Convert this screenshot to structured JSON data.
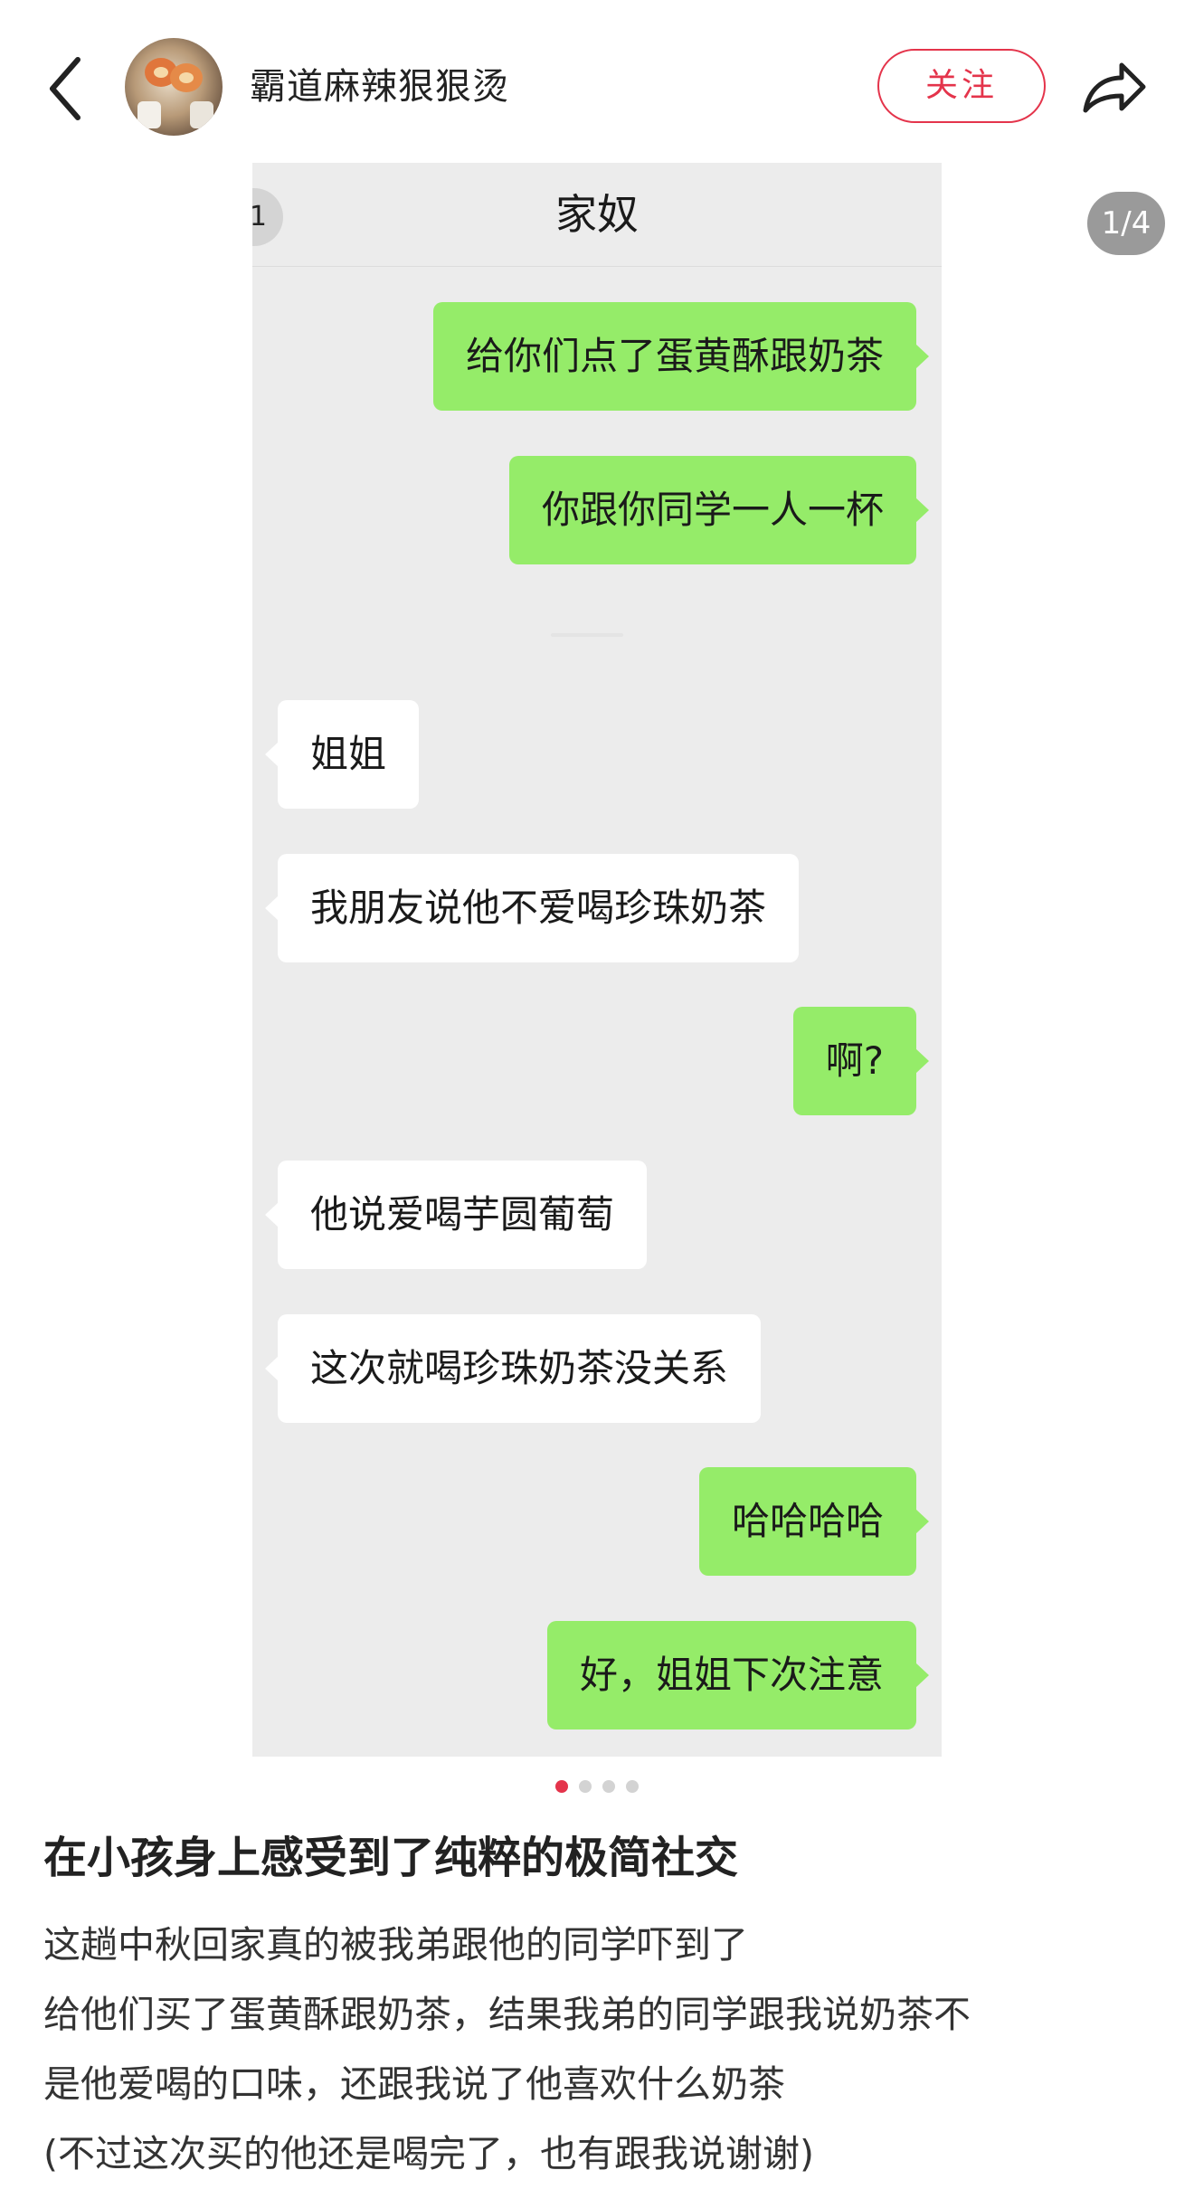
{
  "header": {
    "author_name": "霸道麻辣狠狠烫",
    "follow_label": "关注"
  },
  "image": {
    "counter": "1/4",
    "chat": {
      "title": "家奴",
      "unread_badge": "1",
      "messages": [
        {
          "side": "sent",
          "text": "给你们点了蛋黄酥跟奶茶"
        },
        {
          "side": "sent",
          "text": "你跟你同学一人一杯"
        },
        {
          "side": "recv",
          "text": "姐姐"
        },
        {
          "side": "recv",
          "text": "我朋友说他不爱喝珍珠奶茶"
        },
        {
          "side": "sent",
          "text": "啊?"
        },
        {
          "side": "recv",
          "text": "他说爱喝芋圆葡萄"
        },
        {
          "side": "recv",
          "text": "这次就喝珍珠奶茶没关系"
        },
        {
          "side": "sent",
          "text": "哈哈哈哈"
        },
        {
          "side": "sent",
          "text": "好，姐姐下次注意"
        }
      ]
    },
    "pages_total": 4,
    "active_page": 1
  },
  "post": {
    "title": "在小孩身上感受到了纯粹的极简社交",
    "body_lines": [
      "这趟中秋回家真的被我弟跟他的同学吓到了",
      "给他们买了蛋黄酥跟奶茶，结果我弟的同学跟我说奶茶不",
      "是他爱喝的口味，还跟我说了他喜欢什么奶茶",
      "(不过这次买的他还是喝完了，也有跟我说谢谢)"
    ]
  },
  "colors": {
    "accent": "#e4344b",
    "sent_bubble": "#95ec69",
    "recv_bubble": "#ffffff",
    "chat_background": "#ececec"
  },
  "icons": {
    "back": "chevron-left-icon",
    "share": "share-arrow-icon"
  }
}
